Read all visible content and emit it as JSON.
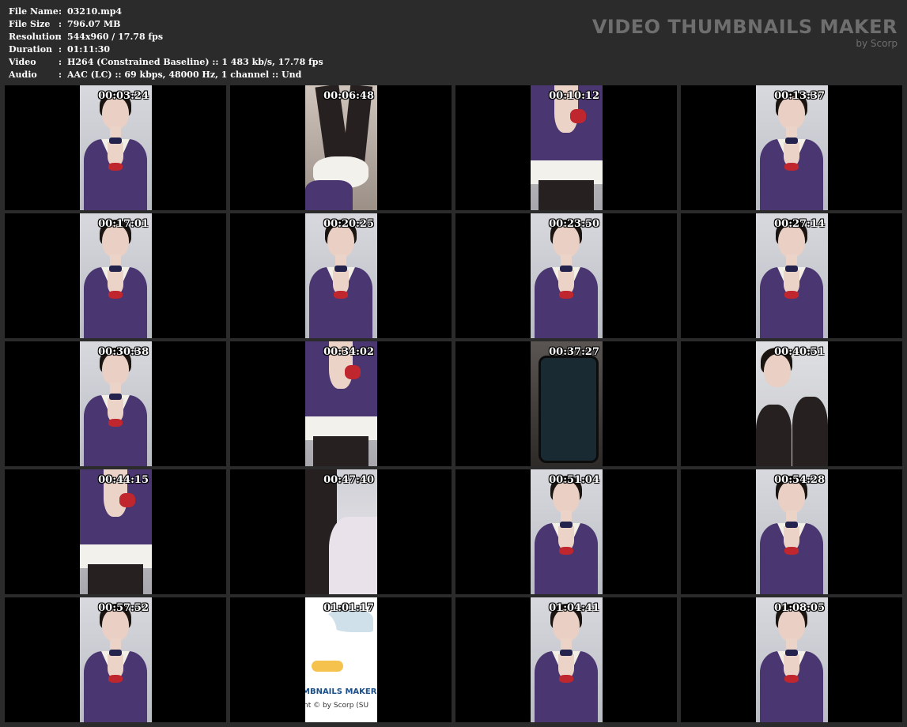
{
  "info": {
    "rows": [
      {
        "key": "File Name",
        "sep": ":",
        "value": "03210.mp4"
      },
      {
        "key": "File Size",
        "sep": ":",
        "value": "796.07 MB"
      },
      {
        "key": "Resolution",
        "sep": ":",
        "value": "544x960 / 17.78 fps"
      },
      {
        "key": "Duration",
        "sep": ":",
        "value": "01:11:30"
      },
      {
        "key": "Video",
        "sep": ":",
        "value": "H264 (Constrained Baseline) :: 1 483 kb/s, 17.78 fps"
      },
      {
        "key": "Audio",
        "sep": ":",
        "value": "AAC (LC) :: 69 kbps, 48000 Hz, 1 channel :: Und"
      }
    ]
  },
  "brand": {
    "title": "VIDEO THUMBNAILS MAKER",
    "subtitle": "by Scorp"
  },
  "thumbnails": [
    {
      "time": "00:03:24",
      "scene": "woman-uniform"
    },
    {
      "time": "00:06:48",
      "scene": "legs-stockings"
    },
    {
      "time": "00:10:12",
      "scene": "torso-closeup"
    },
    {
      "time": "00:13:37",
      "scene": "woman-uniform"
    },
    {
      "time": "00:17:01",
      "scene": "woman-uniform"
    },
    {
      "time": "00:20:25",
      "scene": "woman-uniform"
    },
    {
      "time": "00:23:50",
      "scene": "woman-uniform"
    },
    {
      "time": "00:27:14",
      "scene": "woman-uniform"
    },
    {
      "time": "00:30:38",
      "scene": "woman-uniform"
    },
    {
      "time": "00:34:02",
      "scene": "torso-closeup"
    },
    {
      "time": "00:37:27",
      "scene": "phone-screen"
    },
    {
      "time": "00:40:51",
      "scene": "woman-legs"
    },
    {
      "time": "00:44:15",
      "scene": "torso-closeup"
    },
    {
      "time": "00:47:40",
      "scene": "lace-closeup"
    },
    {
      "time": "00:51:04",
      "scene": "woman-uniform"
    },
    {
      "time": "00:54:28",
      "scene": "woman-uniform"
    },
    {
      "time": "00:57:52",
      "scene": "woman-uniform"
    },
    {
      "time": "01:01:17",
      "scene": "app-logo",
      "logo_text": "MBNAILS MAKER 8",
      "logo_credit": "nt © by Scorp (SU"
    },
    {
      "time": "01:04:41",
      "scene": "woman-uniform"
    },
    {
      "time": "01:08:05",
      "scene": "woman-uniform"
    }
  ],
  "colors": {
    "background": "#2b2b2b",
    "cell": "#000000",
    "brand_text": "#6e6e6e",
    "uniform": "#4a3670"
  }
}
